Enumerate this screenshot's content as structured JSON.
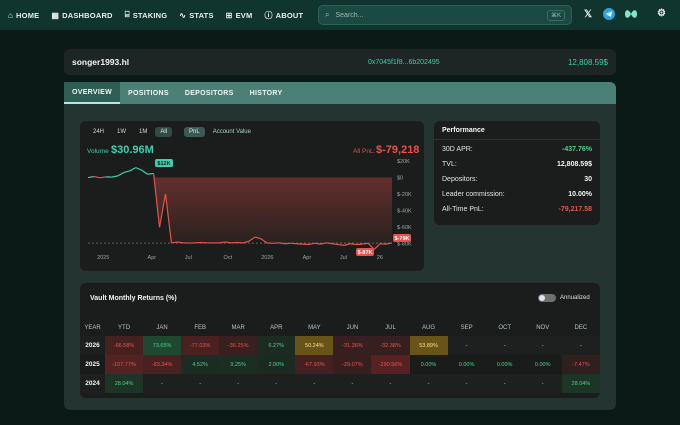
{
  "nav": {
    "items": [
      {
        "label": "HOME",
        "icon": "home-icon"
      },
      {
        "label": "DASHBOARD",
        "icon": "grid-icon"
      },
      {
        "label": "STAKING",
        "icon": "bank-icon"
      },
      {
        "label": "STATS",
        "icon": "chart-line-icon"
      },
      {
        "label": "EVM",
        "icon": "chip-icon"
      },
      {
        "label": "ABOUT",
        "icon": "info-icon"
      }
    ],
    "search_placeholder": "Search...",
    "search_shortcut": "⌘K"
  },
  "vault": {
    "name": "songer1993.hl",
    "address": "0x7045f1f8...6b202495",
    "tvl": "12,808.59$"
  },
  "tabs": [
    "OVERVIEW",
    "POSITIONS",
    "DEPOSITORS",
    "HISTORY"
  ],
  "chart_controls": {
    "ranges": [
      "24H",
      "1W",
      "1M",
      "All"
    ],
    "active_range": "All",
    "modes": [
      "PnL",
      "Account Value"
    ],
    "active_mode": "PnL"
  },
  "chart_summary": {
    "volume_label": "Volume",
    "volume_value": "$30.96M",
    "pnl_label": "All PnL:",
    "pnl_value": "$-79,218",
    "max_tag": "$12K",
    "min_tag": "$-87K",
    "last_tag": "$-79K"
  },
  "chart_data": {
    "type": "line",
    "title": "",
    "xlabel": "",
    "ylabel": "",
    "x_ticks": [
      "2025",
      "Apr",
      "Jul",
      "Oct",
      "2026",
      "Apr",
      "Jul",
      "26"
    ],
    "y_ticks": [
      "$20K",
      "$0",
      "$-20K",
      "$-40K",
      "$-60K",
      "$-80K"
    ],
    "ylim": [
      -90000,
      20000
    ],
    "series": [
      {
        "values": [
          0,
          1200,
          -300,
          800,
          500,
          2000,
          6000,
          8000,
          12000,
          9000,
          4000,
          5000,
          -60000,
          -20000,
          -79000,
          -78000,
          -79000,
          -79200,
          -79000,
          -78500,
          -79000,
          -79000,
          -79000,
          -78000,
          -79000,
          -78500,
          -79000,
          -77000,
          -72000,
          -74000,
          -79000,
          -79500,
          -79000,
          -80000,
          -79500,
          -80000,
          -80500,
          -81000,
          -79500,
          -80500,
          -79000,
          -80000,
          -81000,
          -82000,
          -80000,
          -81000,
          -80500,
          -79500,
          -87000,
          -80000,
          -80500,
          -79218
        ]
      }
    ]
  },
  "performance": {
    "title": "Performance",
    "rows": [
      {
        "label": "30D APR:",
        "value": "-437.76%",
        "color": "#4fd08a"
      },
      {
        "label": "TVL:",
        "value": "12,808.59$",
        "color": "#f2f5f4"
      },
      {
        "label": "Depositors:",
        "value": "30",
        "color": "#f2f5f4"
      },
      {
        "label": "Leader commission:",
        "value": "10.00%",
        "color": "#f2f5f4"
      },
      {
        "label": "All-Time PnL:",
        "value": "-79,217.58",
        "color": "#e8524a"
      }
    ]
  },
  "returns": {
    "title": "Vault Monthly Returns (%)",
    "toggle_label": "Annualized",
    "headers": [
      "YEAR",
      "YTD",
      "JAN",
      "FEB",
      "MAR",
      "APR",
      "MAY",
      "JUN",
      "JUL",
      "AUG",
      "SEP",
      "OCT",
      "NOV",
      "DEC"
    ],
    "rows": [
      {
        "year": "2026",
        "cells": [
          "-66.58%",
          "73.65%",
          "-77.03%",
          "-36.25%",
          "6.27%",
          "50.24%",
          "-31.36%",
          "-32.38%",
          "53.89%",
          "-",
          "-",
          "-",
          "-"
        ]
      },
      {
        "year": "2025",
        "cells": [
          "-107.77%",
          "-83.34%",
          "4.52%",
          "9.25%",
          "2.00%",
          "-67.93%",
          "-29.07%",
          "-290.56%",
          "0.00%",
          "0.00%",
          "0.00%",
          "0.00%",
          "-7.47%"
        ]
      },
      {
        "year": "2024",
        "cells": [
          "28.04%",
          "-",
          "-",
          "-",
          "-",
          "-",
          "-",
          "-",
          "-",
          "-",
          "-",
          "-",
          "28.04%"
        ]
      }
    ]
  }
}
